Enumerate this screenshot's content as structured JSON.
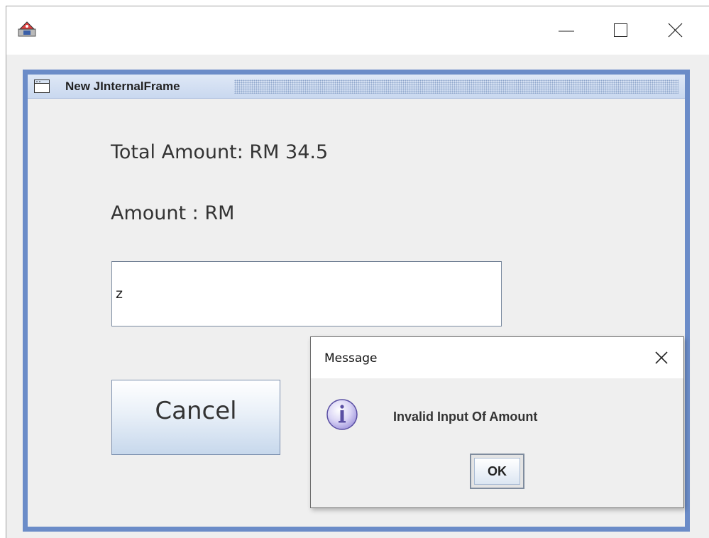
{
  "window": {
    "icon": "java-app-icon",
    "controls": {
      "minimize_icon": "minimize-icon",
      "maximize_icon": "maximize-icon",
      "close_icon": "close-icon"
    }
  },
  "internal_frame": {
    "icon": "frame-window-icon",
    "title": "New JInternalFrame",
    "accent_color": "#6b8cc8"
  },
  "form": {
    "total_label": "Total Amount: RM 34.5",
    "amount_label": "Amount : RM",
    "amount_value": "z",
    "cancel_label": "Cancel"
  },
  "dialog": {
    "title": "Message",
    "close_icon": "close-icon",
    "icon": "info-icon",
    "message": "Invalid Input Of Amount",
    "ok_label": "OK"
  }
}
